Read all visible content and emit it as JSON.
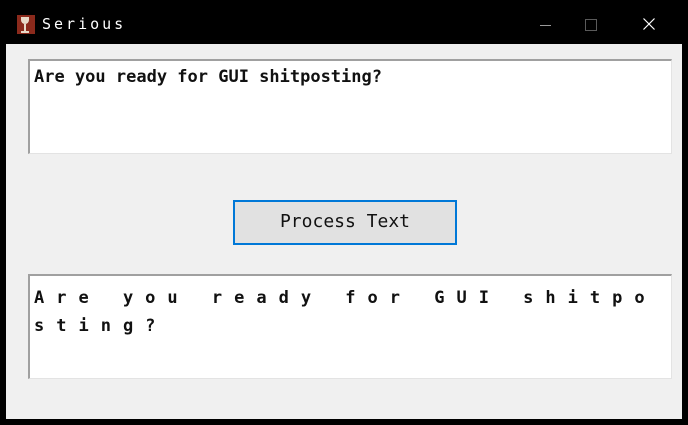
{
  "window": {
    "title": "Serious"
  },
  "input": {
    "value": "Are you ready for GUI shitposting?"
  },
  "actions": {
    "process_label": "Process Text"
  },
  "output": {
    "value": "Are you ready for GUI shitposting?"
  },
  "icons": {
    "app": "wine-glass-icon",
    "minimize": "minimize-icon",
    "maximize": "maximize-icon",
    "close": "close-icon"
  },
  "colors": {
    "titlebar": "#000000",
    "button_border": "#0078d7",
    "window_background": "#f0f0f0"
  }
}
